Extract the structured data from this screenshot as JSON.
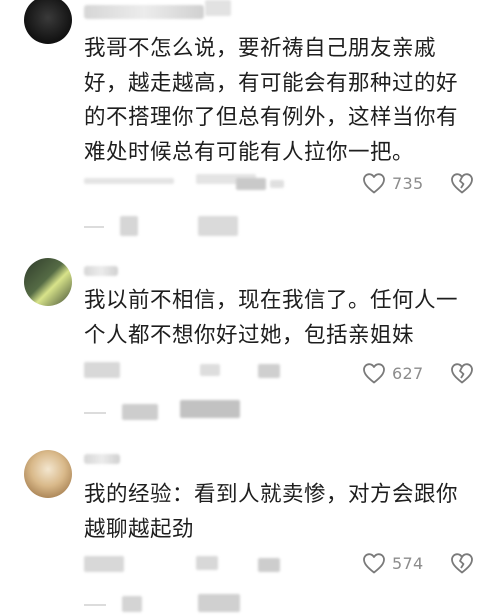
{
  "comments": [
    {
      "text": "我哥不怎么说，要祈祷自己朋友亲戚好，越走越高，有可能会有那种过的好的不搭理你了但总有例外，这样当你有难处时候总有可能有人拉你一把。",
      "likes": "735"
    },
    {
      "text": "我以前不相信，现在我信了。任何人一个人都不想你好过她，包括亲姐妹",
      "likes": "627"
    },
    {
      "text": "我的经验：看到人就卖惨，对方会跟你越聊越起劲",
      "likes": "574"
    }
  ],
  "icons": {
    "like": "heart-outline-icon",
    "dislike": "broken-heart-icon"
  },
  "colors": {
    "text": "#1e1e1e",
    "meta": "#8c8c8c",
    "icon": "#7a7a7a",
    "background": "#ffffff"
  }
}
